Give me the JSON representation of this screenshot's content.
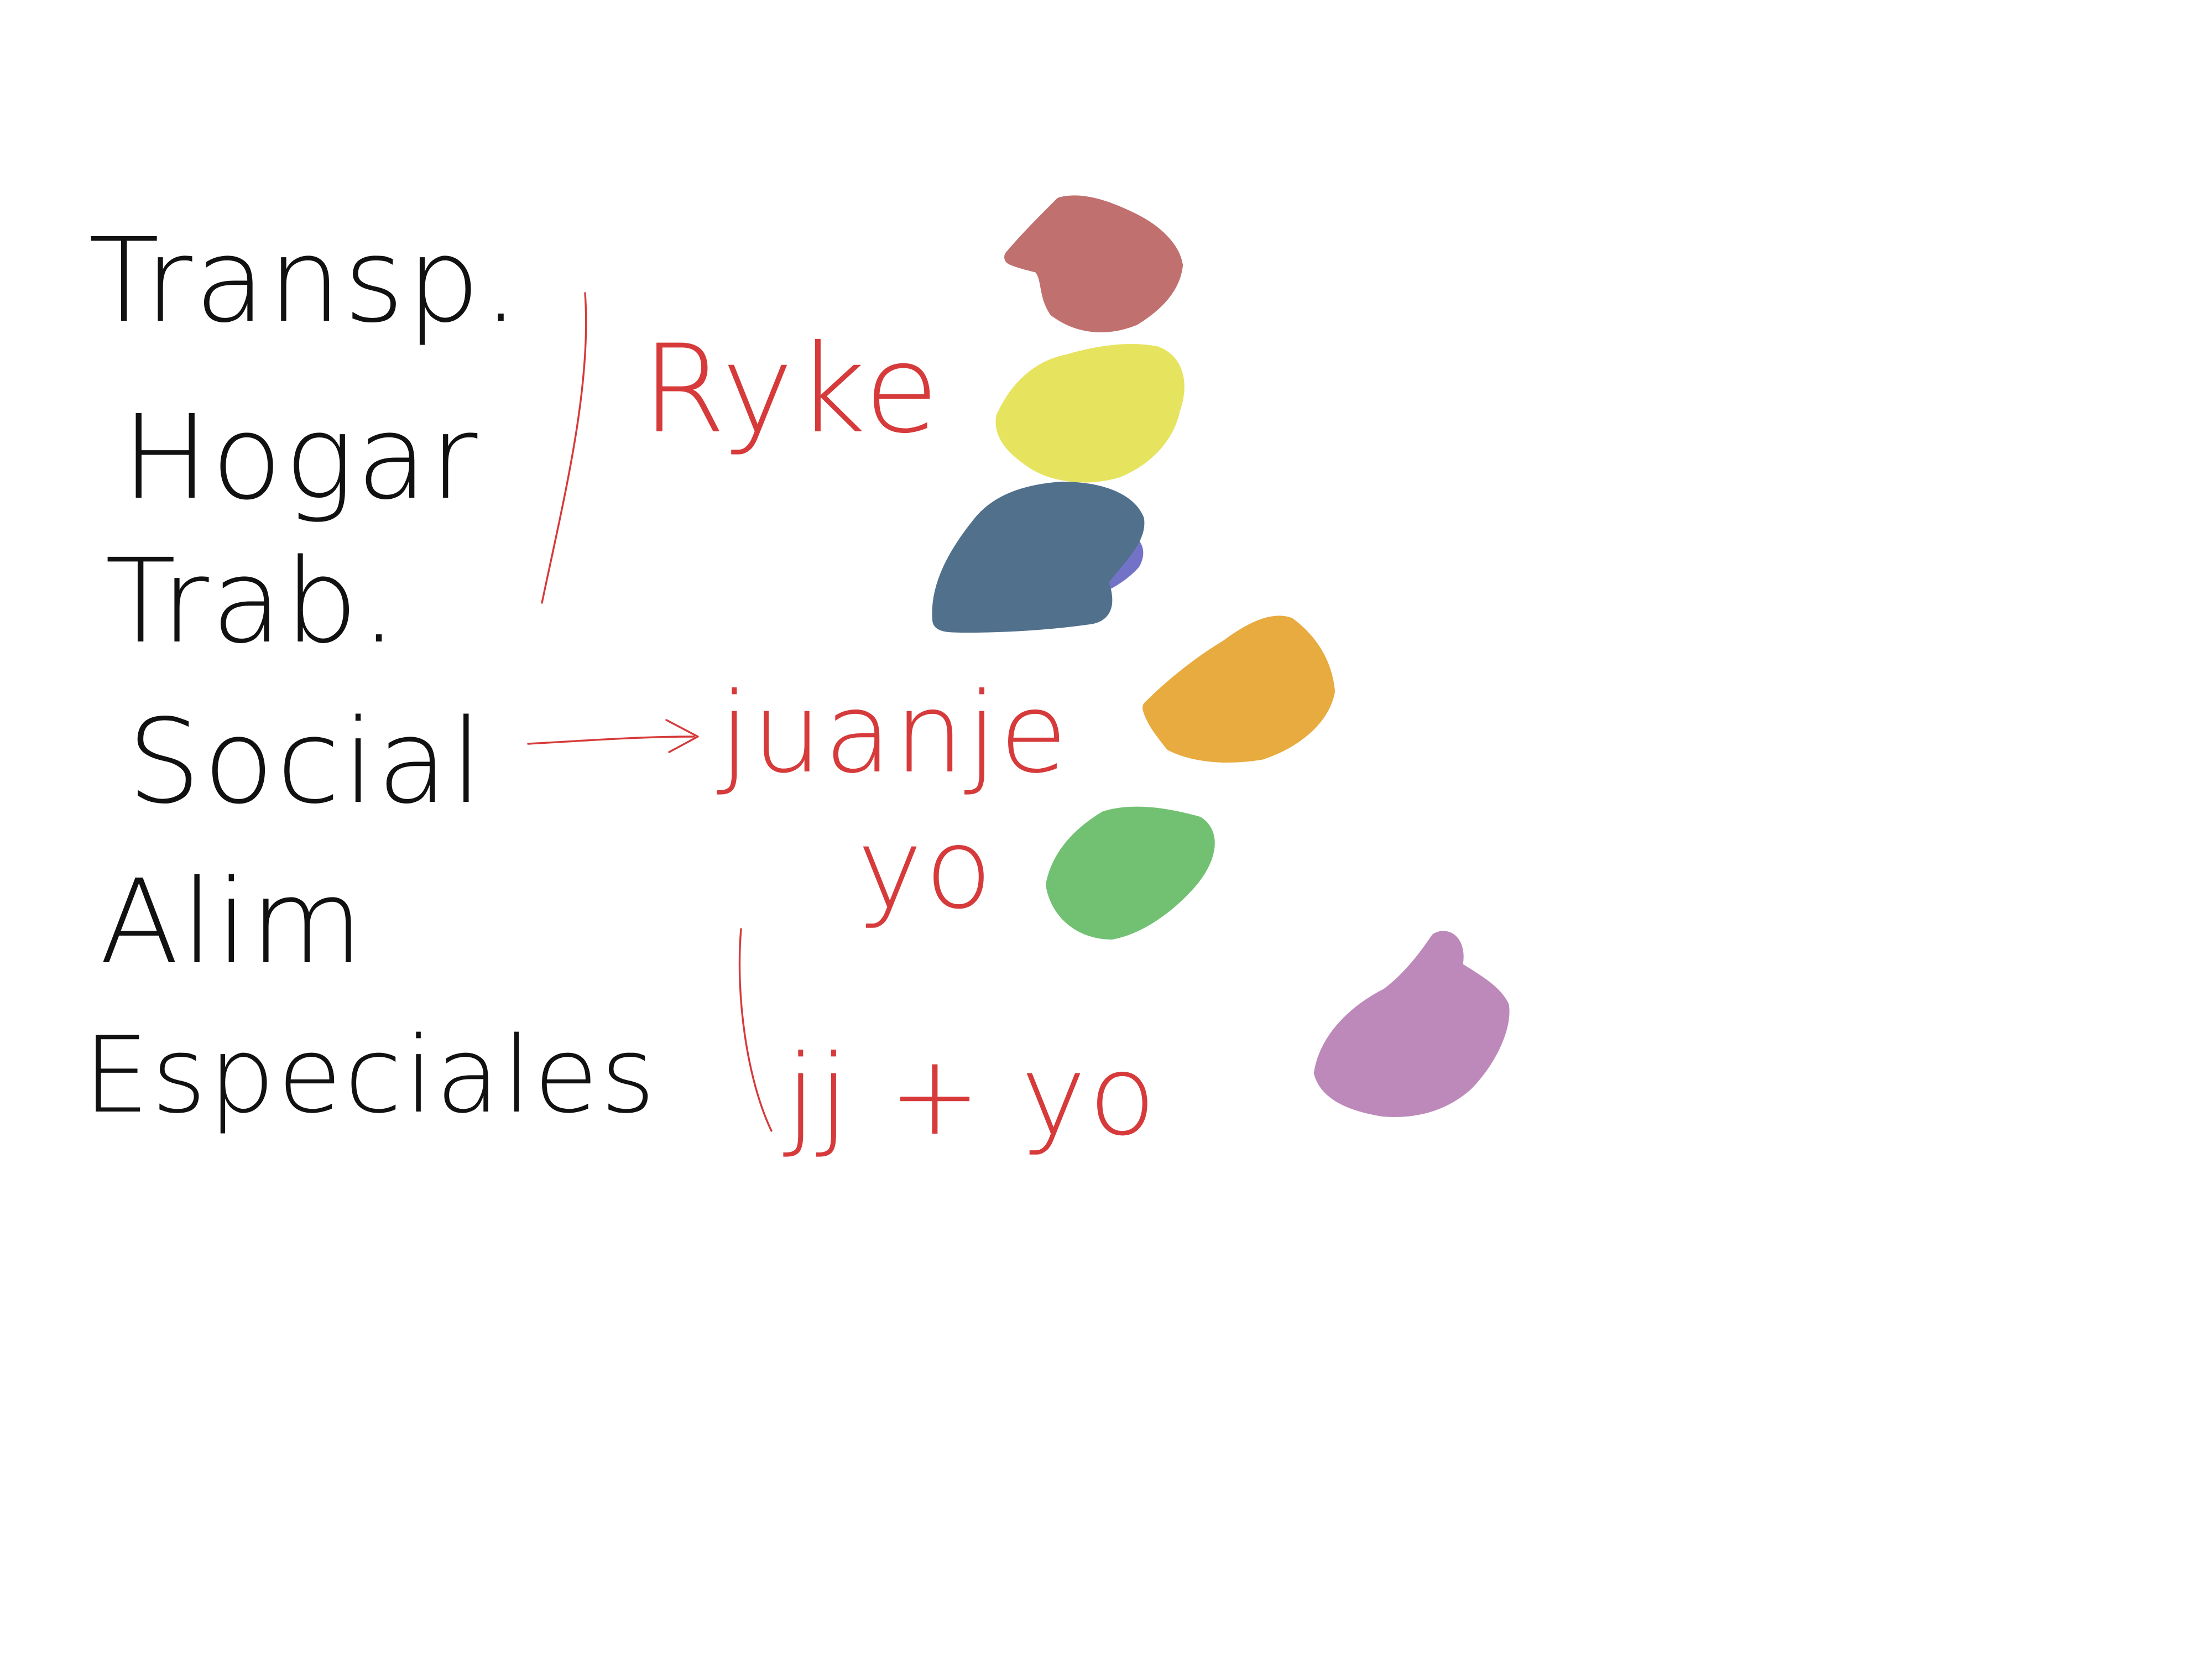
{
  "categories": [
    {
      "label": "Transp.",
      "swatch": {
        "name": "rose-swatch",
        "color": "#c0706e"
      }
    },
    {
      "label": "Hogar",
      "swatch": {
        "name": "yellow-swatch",
        "color": "#e6e35e"
      }
    },
    {
      "label": "Trab.",
      "swatch": {
        "name": "slate-blue-swatch",
        "color": "#51708c"
      }
    },
    {
      "label": "Social",
      "swatch": {
        "name": "orange-swatch",
        "color": "#e8ab3f"
      }
    },
    {
      "label": "Alim",
      "swatch": {
        "name": "green-swatch",
        "color": "#72c173"
      }
    },
    {
      "label": "Especiales",
      "swatch": {
        "name": "purple-swatch",
        "color": "#bd89ba"
      }
    }
  ],
  "annotations": {
    "bracket_note": "Ryke",
    "social_note": "juanje",
    "alim_note": "yo",
    "especiales_note": "jj + yo"
  },
  "colors": {
    "black_ink": "#111111",
    "red_ink": "#d63a3a",
    "background": "#ffffff"
  }
}
